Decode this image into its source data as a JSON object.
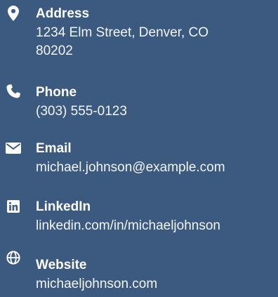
{
  "contacts": [
    {
      "key": "address",
      "icon": "map-pin-icon",
      "label": "Address",
      "value_line1": "1234 Elm Street, Denver, CO",
      "value_line2": "80202"
    },
    {
      "key": "phone",
      "icon": "phone-icon",
      "label": "Phone",
      "value": "(303) 555-0123"
    },
    {
      "key": "email",
      "icon": "envelope-icon",
      "label": "Email",
      "value": "michael.johnson@example.com"
    },
    {
      "key": "linkedin",
      "icon": "linkedin-icon",
      "label": "LinkedIn",
      "value": "linkedin.com/in/michaeljohnson"
    },
    {
      "key": "website",
      "icon": "globe-icon",
      "label": "Website",
      "value": "michaeljohnson.com"
    }
  ],
  "colors": {
    "background": "#3c5a80",
    "text": "#ffffff"
  }
}
